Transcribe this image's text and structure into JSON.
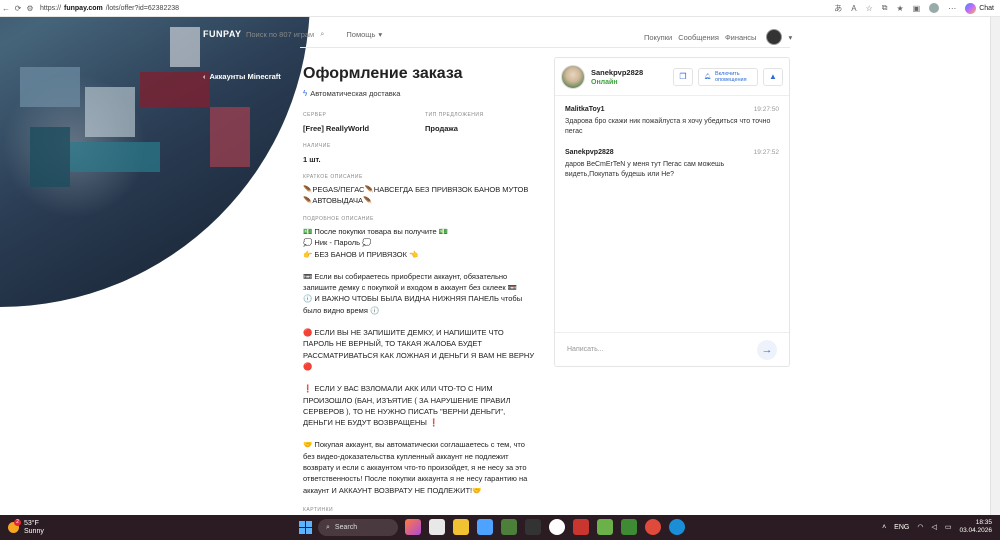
{
  "browser": {
    "url_prefix": "https://",
    "url_domain": "funpay.com",
    "url_path": "/lots/offer?id=62382238",
    "chat_label": "Chat"
  },
  "header": {
    "logo": "FUNPAY",
    "search_placeholder": "Поиск по 807 играм",
    "help": "Помощь",
    "nav": [
      "Покупки",
      "Сообщения",
      "Финансы"
    ],
    "back_link": "Аккаунты Minecraft"
  },
  "order": {
    "title": "Оформление заказа",
    "auto_delivery": "Автоматическая доставка",
    "params": [
      {
        "label": "СЕРВЕР",
        "value": "[Free] ReallyWorld"
      },
      {
        "label": "ТИП ПРЕДЛОЖЕНИЯ",
        "value": "Продажа"
      },
      {
        "label": "НАЛИЧИЕ",
        "value": "1 шт."
      }
    ],
    "short_label": "КРАТКОЕ ОПИСАНИЕ",
    "short_text": "🪶PEGAS/ПЕГАС🪶НАВСЕГДА БЕЗ ПРИВЯЗОК БАНОВ МУТОВ 🪶АВТОВЫДАЧА🪶",
    "long_label": "ПОДРОБНОЕ ОПИСАНИЕ",
    "long_paragraphs": [
      "💵 После покупки товара вы получите 💵\n💭 Ник - Пароль 💭\n👉 БЕЗ БАНОВ И ПРИВЯЗОК 👈",
      "📼 Если вы собираетесь приобрести аккаунт, обязательно запишите демку с покупкой и входом в аккаунт без склеек 📼\n🕕 И ВАЖНО ЧТОБЫ БЫЛА ВИДНА НИЖНЯЯ ПАНЕЛЬ чтобы было видно время 🕕",
      "🔴 ЕСЛИ ВЫ НЕ ЗАПИШИТЕ ДЕМКУ, И НАПИШИТЕ ЧТО ПАРОЛЬ НЕ ВЕРНЫЙ, ТО ТАКАЯ ЖАЛОБА БУДЕТ РАССМАТРИВАТЬСЯ КАК ЛОЖНАЯ И ДЕНЬГИ Я ВАМ НЕ ВЕРНУ 🔴",
      "❗ ЕСЛИ У ВАС ВЗЛОМАЛИ АКК ИЛИ ЧТО-ТО С НИМ ПРОИЗОШЛО (БАН, ИЗЪЯТИЕ ( ЗА НАРУШЕНИЕ ПРАВИЛ СЕРВЕРОВ ), ТО НЕ НУЖНО ПИСАТЬ \"ВЕРНИ ДЕНЬГИ\", ДЕНЬГИ НЕ БУДУТ ВОЗВРАЩЕНЫ ❗",
      "🤝 Покупая аккаунт, вы автоматически соглашаетесь с тем, что без видео-доказательства купленный аккаунт не подлежит возврату и если с аккаунтом что-то произойдет, я не несу за это ответственность! После покупки аккаунта я не несу гарантию на аккаунт И АККАУНТ ВОЗВРАТУ НЕ ПОДЛЕЖИТ!🤝"
    ],
    "pics_label": "КАРТИНКИ"
  },
  "chat": {
    "seller": "Sanekpvp2828",
    "status": "Онлайн",
    "notify_button": "Включить оповещения",
    "messages": [
      {
        "author": "MalitkaToy1",
        "time": "19:27:50",
        "text": "Здарова бро скажи ник пожайлуста я хочу убедиться что точно пегас"
      },
      {
        "author": "Sanekpvp2828",
        "time": "19:27:52",
        "text": "даров BeCmErTeN у меня тут Пегас сам можешь видеть,Покупать будешь или Не?"
      }
    ],
    "input_placeholder": "Написать..."
  },
  "taskbar": {
    "weather_temp": "53°F",
    "weather_desc": "Sunny",
    "weather_badge": "2",
    "search": "Search",
    "lang": "ENG",
    "time": "18:35",
    "date": "03.04.2026"
  }
}
